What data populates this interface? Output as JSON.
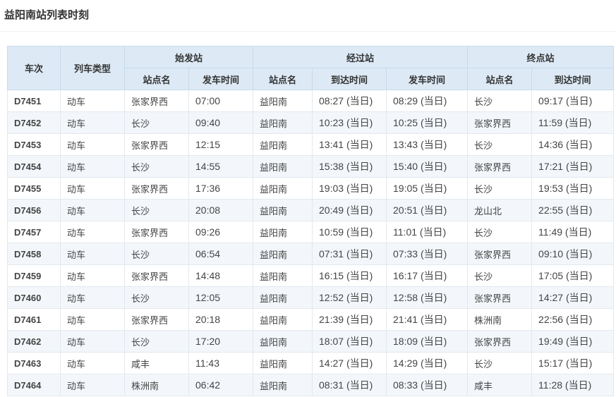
{
  "page": {
    "title": "益阳南站列表时刻"
  },
  "table": {
    "headers": {
      "train_no": "车次",
      "train_type": "列车类型",
      "origin": "始发站",
      "via": "经过站",
      "terminal": "终点站",
      "origin_station": "站点名",
      "origin_depart": "发车时间",
      "via_station": "站点名",
      "via_arrive": "到达时间",
      "via_depart": "发车时间",
      "terminal_station": "站点名",
      "terminal_arrive": "到达时间"
    },
    "rows": [
      [
        "D7451",
        "动车",
        "张家界西",
        "07:00",
        "益阳南",
        "08:27 (当日)",
        "08:29 (当日)",
        "长沙",
        "09:17 (当日)"
      ],
      [
        "D7452",
        "动车",
        "长沙",
        "09:40",
        "益阳南",
        "10:23 (当日)",
        "10:25 (当日)",
        "张家界西",
        "11:59 (当日)"
      ],
      [
        "D7453",
        "动车",
        "张家界西",
        "12:15",
        "益阳南",
        "13:41 (当日)",
        "13:43 (当日)",
        "长沙",
        "14:36 (当日)"
      ],
      [
        "D7454",
        "动车",
        "长沙",
        "14:55",
        "益阳南",
        "15:38 (当日)",
        "15:40 (当日)",
        "张家界西",
        "17:21 (当日)"
      ],
      [
        "D7455",
        "动车",
        "张家界西",
        "17:36",
        "益阳南",
        "19:03 (当日)",
        "19:05 (当日)",
        "长沙",
        "19:53 (当日)"
      ],
      [
        "D7456",
        "动车",
        "长沙",
        "20:08",
        "益阳南",
        "20:49 (当日)",
        "20:51 (当日)",
        "龙山北",
        "22:55 (当日)"
      ],
      [
        "D7457",
        "动车",
        "张家界西",
        "09:26",
        "益阳南",
        "10:59 (当日)",
        "11:01 (当日)",
        "长沙",
        "11:49 (当日)"
      ],
      [
        "D7458",
        "动车",
        "长沙",
        "06:54",
        "益阳南",
        "07:31 (当日)",
        "07:33 (当日)",
        "张家界西",
        "09:10 (当日)"
      ],
      [
        "D7459",
        "动车",
        "张家界西",
        "14:48",
        "益阳南",
        "16:15 (当日)",
        "16:17 (当日)",
        "长沙",
        "17:05 (当日)"
      ],
      [
        "D7460",
        "动车",
        "长沙",
        "12:05",
        "益阳南",
        "12:52 (当日)",
        "12:58 (当日)",
        "张家界西",
        "14:27 (当日)"
      ],
      [
        "D7461",
        "动车",
        "张家界西",
        "20:18",
        "益阳南",
        "21:39 (当日)",
        "21:41 (当日)",
        "株洲南",
        "22:56 (当日)"
      ],
      [
        "D7462",
        "动车",
        "长沙",
        "17:20",
        "益阳南",
        "18:07 (当日)",
        "18:09 (当日)",
        "张家界西",
        "19:49 (当日)"
      ],
      [
        "D7463",
        "动车",
        "咸丰",
        "11:43",
        "益阳南",
        "14:27 (当日)",
        "14:29 (当日)",
        "长沙",
        "15:17 (当日)"
      ],
      [
        "D7464",
        "动车",
        "株洲南",
        "06:42",
        "益阳南",
        "08:31 (当日)",
        "08:33 (当日)",
        "咸丰",
        "11:28 (当日)"
      ]
    ]
  },
  "colors": {
    "header_bg": "#ddeaf6",
    "header_border": "#c7daeb",
    "row_alt_bg": "#f3f7fb",
    "cell_border": "#e3e8ee",
    "text": "#333333"
  }
}
